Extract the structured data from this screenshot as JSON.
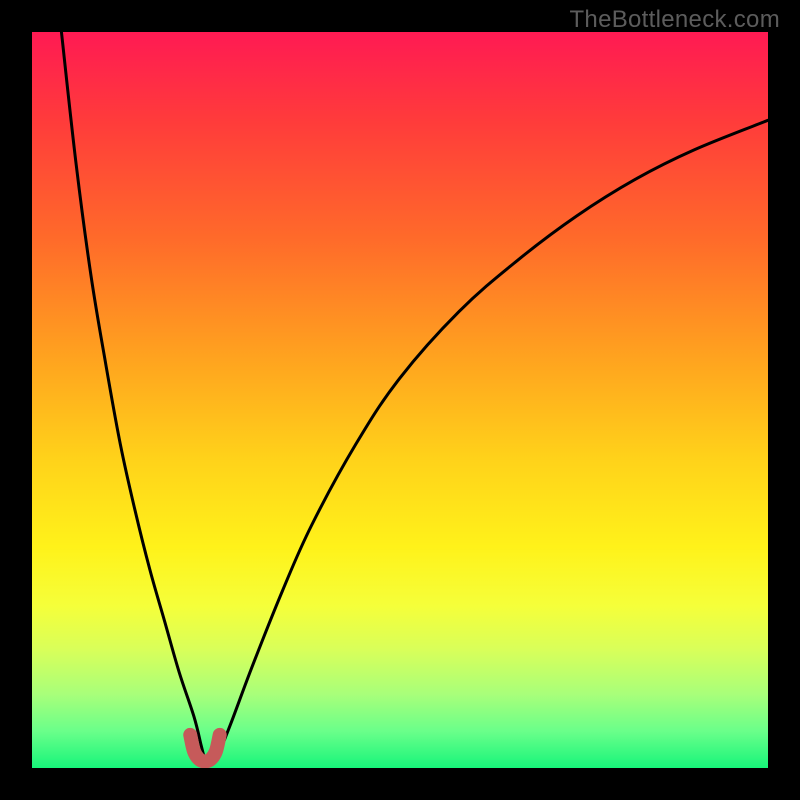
{
  "watermark": "TheBottleneck.com",
  "chart_data": {
    "type": "line",
    "title": "",
    "xlabel": "",
    "ylabel": "",
    "xlim": [
      0,
      100
    ],
    "ylim": [
      0,
      100
    ],
    "grid": false,
    "legend": false,
    "annotations": [],
    "series": [
      {
        "name": "left-curve",
        "color": "#000000",
        "x": [
          4,
          6,
          8,
          10,
          12,
          14,
          16,
          18,
          20,
          22,
          23,
          23.5
        ],
        "values": [
          100,
          82,
          67,
          55,
          44,
          35,
          27,
          20,
          13,
          7,
          3,
          1
        ]
      },
      {
        "name": "right-curve",
        "color": "#000000",
        "x": [
          25,
          27,
          30,
          34,
          38,
          44,
          50,
          58,
          66,
          74,
          82,
          90,
          100
        ],
        "values": [
          1,
          6,
          14,
          24,
          33,
          44,
          53,
          62,
          69,
          75,
          80,
          84,
          88
        ]
      },
      {
        "name": "bottom-marker",
        "color": "#c65a5a",
        "x": [
          21.5,
          22,
          22.7,
          23.5,
          24.3,
          25,
          25.5
        ],
        "values": [
          4.5,
          2.3,
          1.2,
          0.9,
          1.2,
          2.3,
          4.5
        ]
      }
    ],
    "background_gradient_stops": [
      {
        "pos": 0,
        "color": "#ff1a53"
      },
      {
        "pos": 12,
        "color": "#ff3b3b"
      },
      {
        "pos": 28,
        "color": "#ff6a2a"
      },
      {
        "pos": 44,
        "color": "#ffa21f"
      },
      {
        "pos": 58,
        "color": "#ffd21a"
      },
      {
        "pos": 70,
        "color": "#fff21a"
      },
      {
        "pos": 78,
        "color": "#f5ff3a"
      },
      {
        "pos": 84,
        "color": "#d8ff5a"
      },
      {
        "pos": 90,
        "color": "#a8ff7a"
      },
      {
        "pos": 95,
        "color": "#6aff8a"
      },
      {
        "pos": 100,
        "color": "#17f57a"
      }
    ]
  }
}
